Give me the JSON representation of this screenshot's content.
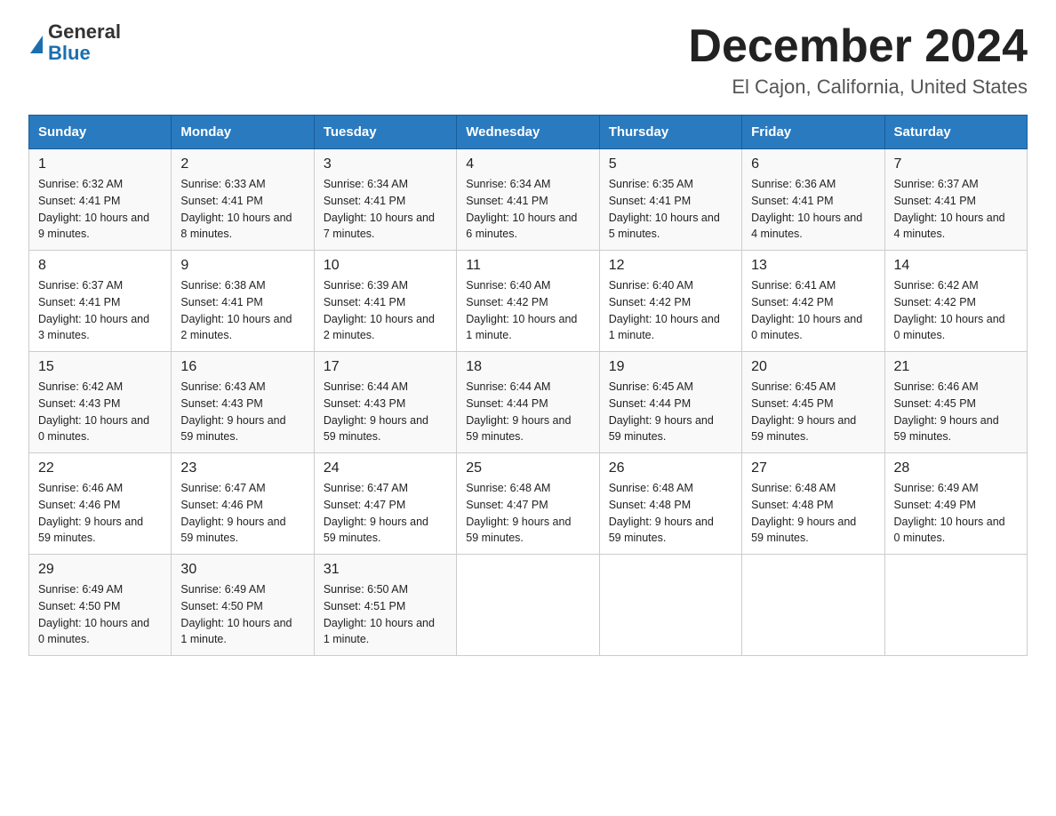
{
  "header": {
    "logo_line1": "General",
    "logo_line2": "Blue",
    "title": "December 2024",
    "subtitle": "El Cajon, California, United States"
  },
  "days_of_week": [
    "Sunday",
    "Monday",
    "Tuesday",
    "Wednesday",
    "Thursday",
    "Friday",
    "Saturday"
  ],
  "weeks": [
    [
      {
        "day": "1",
        "sunrise": "6:32 AM",
        "sunset": "4:41 PM",
        "daylight": "10 hours and 9 minutes."
      },
      {
        "day": "2",
        "sunrise": "6:33 AM",
        "sunset": "4:41 PM",
        "daylight": "10 hours and 8 minutes."
      },
      {
        "day": "3",
        "sunrise": "6:34 AM",
        "sunset": "4:41 PM",
        "daylight": "10 hours and 7 minutes."
      },
      {
        "day": "4",
        "sunrise": "6:34 AM",
        "sunset": "4:41 PM",
        "daylight": "10 hours and 6 minutes."
      },
      {
        "day": "5",
        "sunrise": "6:35 AM",
        "sunset": "4:41 PM",
        "daylight": "10 hours and 5 minutes."
      },
      {
        "day": "6",
        "sunrise": "6:36 AM",
        "sunset": "4:41 PM",
        "daylight": "10 hours and 4 minutes."
      },
      {
        "day": "7",
        "sunrise": "6:37 AM",
        "sunset": "4:41 PM",
        "daylight": "10 hours and 4 minutes."
      }
    ],
    [
      {
        "day": "8",
        "sunrise": "6:37 AM",
        "sunset": "4:41 PM",
        "daylight": "10 hours and 3 minutes."
      },
      {
        "day": "9",
        "sunrise": "6:38 AM",
        "sunset": "4:41 PM",
        "daylight": "10 hours and 2 minutes."
      },
      {
        "day": "10",
        "sunrise": "6:39 AM",
        "sunset": "4:41 PM",
        "daylight": "10 hours and 2 minutes."
      },
      {
        "day": "11",
        "sunrise": "6:40 AM",
        "sunset": "4:42 PM",
        "daylight": "10 hours and 1 minute."
      },
      {
        "day": "12",
        "sunrise": "6:40 AM",
        "sunset": "4:42 PM",
        "daylight": "10 hours and 1 minute."
      },
      {
        "day": "13",
        "sunrise": "6:41 AM",
        "sunset": "4:42 PM",
        "daylight": "10 hours and 0 minutes."
      },
      {
        "day": "14",
        "sunrise": "6:42 AM",
        "sunset": "4:42 PM",
        "daylight": "10 hours and 0 minutes."
      }
    ],
    [
      {
        "day": "15",
        "sunrise": "6:42 AM",
        "sunset": "4:43 PM",
        "daylight": "10 hours and 0 minutes."
      },
      {
        "day": "16",
        "sunrise": "6:43 AM",
        "sunset": "4:43 PM",
        "daylight": "9 hours and 59 minutes."
      },
      {
        "day": "17",
        "sunrise": "6:44 AM",
        "sunset": "4:43 PM",
        "daylight": "9 hours and 59 minutes."
      },
      {
        "day": "18",
        "sunrise": "6:44 AM",
        "sunset": "4:44 PM",
        "daylight": "9 hours and 59 minutes."
      },
      {
        "day": "19",
        "sunrise": "6:45 AM",
        "sunset": "4:44 PM",
        "daylight": "9 hours and 59 minutes."
      },
      {
        "day": "20",
        "sunrise": "6:45 AM",
        "sunset": "4:45 PM",
        "daylight": "9 hours and 59 minutes."
      },
      {
        "day": "21",
        "sunrise": "6:46 AM",
        "sunset": "4:45 PM",
        "daylight": "9 hours and 59 minutes."
      }
    ],
    [
      {
        "day": "22",
        "sunrise": "6:46 AM",
        "sunset": "4:46 PM",
        "daylight": "9 hours and 59 minutes."
      },
      {
        "day": "23",
        "sunrise": "6:47 AM",
        "sunset": "4:46 PM",
        "daylight": "9 hours and 59 minutes."
      },
      {
        "day": "24",
        "sunrise": "6:47 AM",
        "sunset": "4:47 PM",
        "daylight": "9 hours and 59 minutes."
      },
      {
        "day": "25",
        "sunrise": "6:48 AM",
        "sunset": "4:47 PM",
        "daylight": "9 hours and 59 minutes."
      },
      {
        "day": "26",
        "sunrise": "6:48 AM",
        "sunset": "4:48 PM",
        "daylight": "9 hours and 59 minutes."
      },
      {
        "day": "27",
        "sunrise": "6:48 AM",
        "sunset": "4:48 PM",
        "daylight": "9 hours and 59 minutes."
      },
      {
        "day": "28",
        "sunrise": "6:49 AM",
        "sunset": "4:49 PM",
        "daylight": "10 hours and 0 minutes."
      }
    ],
    [
      {
        "day": "29",
        "sunrise": "6:49 AM",
        "sunset": "4:50 PM",
        "daylight": "10 hours and 0 minutes."
      },
      {
        "day": "30",
        "sunrise": "6:49 AM",
        "sunset": "4:50 PM",
        "daylight": "10 hours and 1 minute."
      },
      {
        "day": "31",
        "sunrise": "6:50 AM",
        "sunset": "4:51 PM",
        "daylight": "10 hours and 1 minute."
      },
      null,
      null,
      null,
      null
    ]
  ],
  "sunrise_label": "Sunrise:",
  "sunset_label": "Sunset:",
  "daylight_label": "Daylight:"
}
